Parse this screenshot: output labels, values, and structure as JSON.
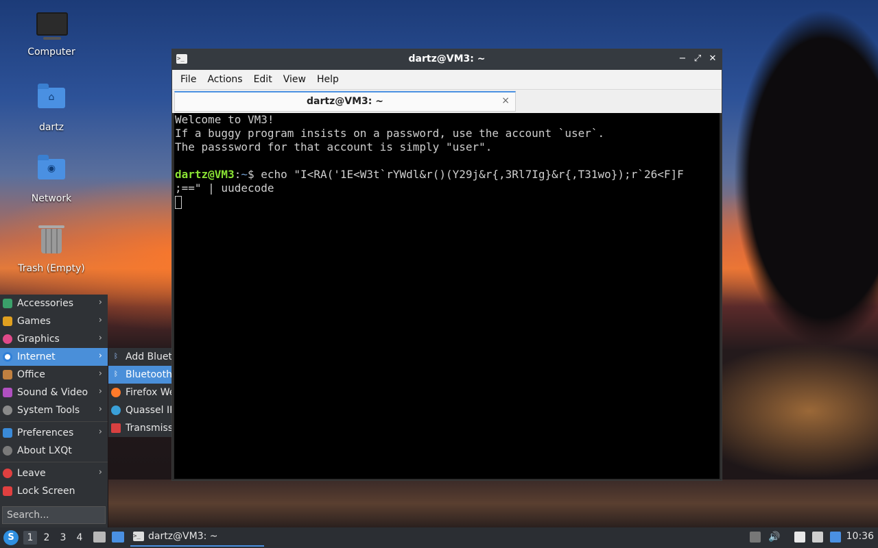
{
  "desktop": {
    "icons": [
      {
        "label": "Computer"
      },
      {
        "label": "dartz"
      },
      {
        "label": "Network"
      },
      {
        "label": "Trash (Empty)"
      }
    ]
  },
  "window": {
    "title": "dartz@VM3: ~",
    "menu": [
      "File",
      "Actions",
      "Edit",
      "View",
      "Help"
    ],
    "tab_title": "dartz@VM3: ~",
    "tab_close": "×",
    "terminal": {
      "welcome_lines": [
        "Welcome to VM3!",
        "If a buggy program insists on a password, use the account `user`.",
        "The passsword for that account is simply \"user\"."
      ],
      "prompt_user": "dartz@VM3",
      "prompt_sep": ":",
      "prompt_path": "~",
      "prompt_symbol": "$ ",
      "command_line1": "echo \"I<RA('1E<W3t`rYWdl&r()(Y29j&r{,3Rl7Ig}&r{,T31wo});r`26<F]F",
      "command_line2": ";==\" | uudecode"
    }
  },
  "start_menu": {
    "items": [
      {
        "label": "Accessories",
        "color": "#3aa06a"
      },
      {
        "label": "Games",
        "color": "#e0a020"
      },
      {
        "label": "Graphics",
        "color": "#e04a8a"
      },
      {
        "label": "Internet",
        "color": "#2f7fd8"
      },
      {
        "label": "Office",
        "color": "#c08040"
      },
      {
        "label": "Sound & Video",
        "color": "#b050c0"
      },
      {
        "label": "System Tools",
        "color": "#8a8a8a"
      },
      {
        "label": "Preferences",
        "color": "#3a8ad8"
      },
      {
        "label": "About LXQt",
        "color": "#7a7a7a"
      },
      {
        "label": "Leave",
        "color": "#e04040"
      },
      {
        "label": "Lock Screen",
        "color": "#e04040"
      }
    ],
    "search_placeholder": "Search...",
    "submenu": [
      {
        "label": "Add Bluetooth"
      },
      {
        "label": "Bluetooth"
      },
      {
        "label": "Firefox Web"
      },
      {
        "label": "Quassel IRC"
      },
      {
        "label": "Transmission"
      }
    ]
  },
  "taskbar": {
    "workspaces": [
      "1",
      "2",
      "3",
      "4"
    ],
    "task_title": "dartz@VM3: ~",
    "clock": "10:36"
  }
}
